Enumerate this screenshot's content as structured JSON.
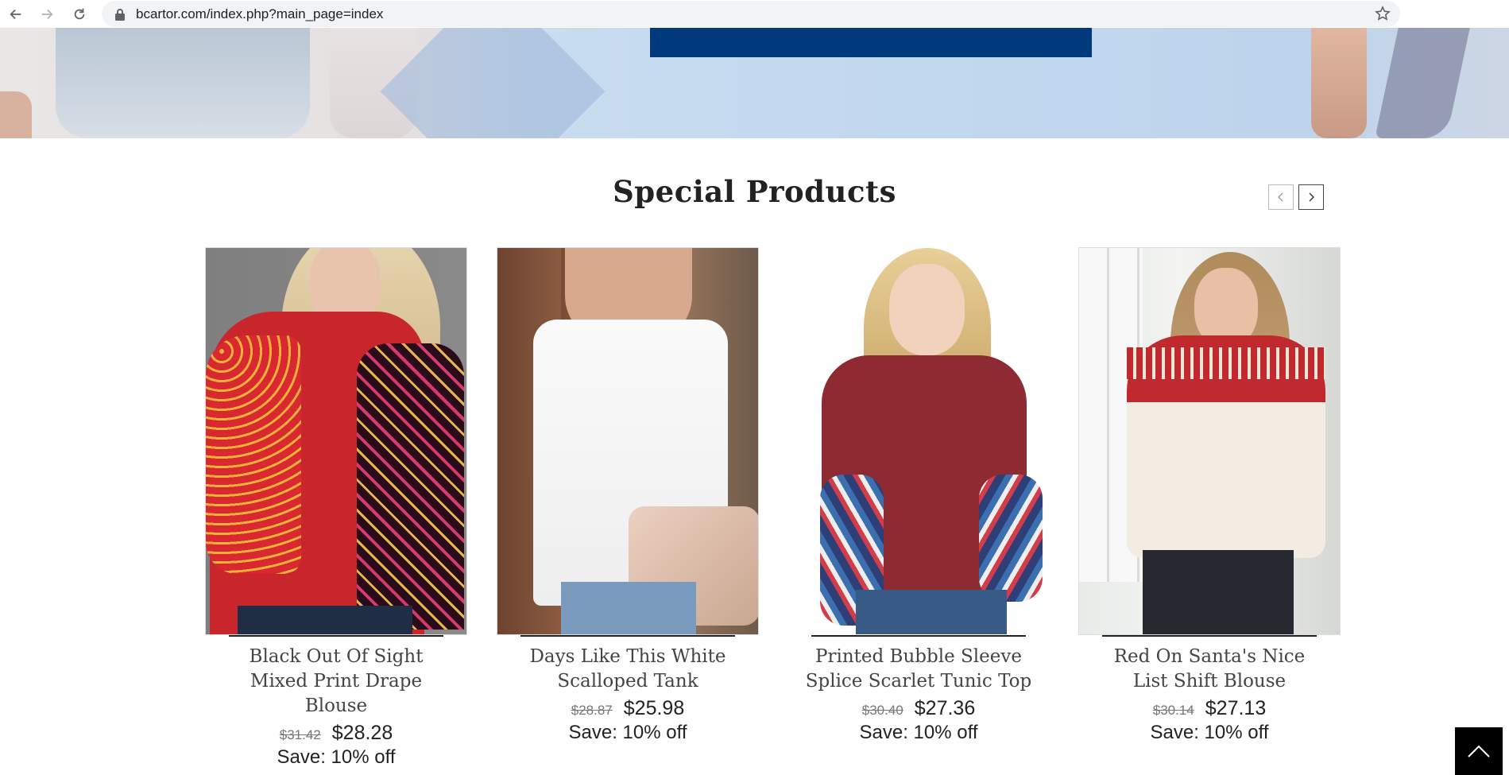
{
  "browser": {
    "url_domain": "bcartor.com",
    "url_path": "/index.php?main_page=index",
    "back_icon": "arrow-left-icon",
    "forward_icon": "arrow-right-icon",
    "reload_icon": "reload-icon",
    "lock_icon": "lock-icon",
    "bookmark_icon": "star-icon"
  },
  "section": {
    "title": "Special Products",
    "prev_icon": "chevron-left-icon",
    "next_icon": "chevron-right-icon"
  },
  "products": [
    {
      "name": "Black Out Of Sight Mixed Print Drape Blouse",
      "old_price": "$31.42",
      "price": "$28.28",
      "save": "Save: 10% off"
    },
    {
      "name": "Days Like This White Scalloped Tank",
      "old_price": "$28.87",
      "price": "$25.98",
      "save": "Save: 10% off"
    },
    {
      "name": "Printed Bubble Sleeve Splice Scarlet Tunic Top",
      "old_price": "$30.40",
      "price": "$27.36",
      "save": "Save: 10% off"
    },
    {
      "name": "Red On Santa's Nice List Shift Blouse",
      "old_price": "$30.14",
      "price": "$27.13",
      "save": "Save: 10% off"
    }
  ],
  "back_to_top_icon": "chevron-up-icon",
  "colors": {
    "hero_banner_block": "#003a7d",
    "text_dark": "#222222"
  }
}
